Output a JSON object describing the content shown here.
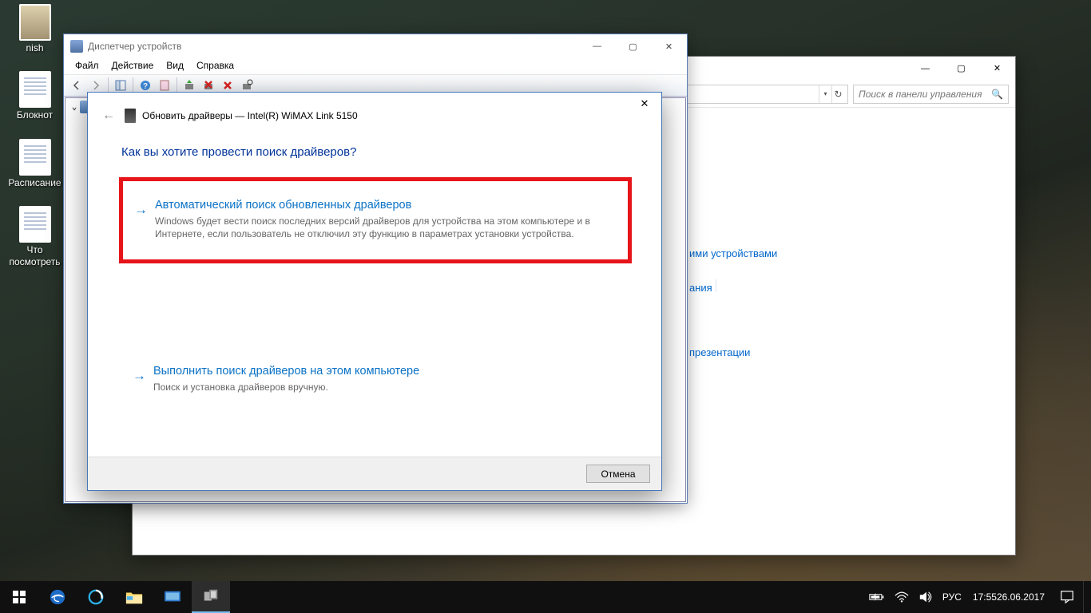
{
  "desktop": {
    "icons": [
      {
        "label": "nish",
        "type": "img"
      },
      {
        "label": "Блокнот",
        "type": "txt"
      },
      {
        "label": "Расписание",
        "type": "txt"
      },
      {
        "label": "Что посмотреть",
        "type": "txt"
      }
    ]
  },
  "controlPanel": {
    "searchPlaceholder": "Поиск в панели управления",
    "links": {
      "a": "ими устройствами",
      "b": "ания",
      "c": "презентации"
    }
  },
  "deviceManager": {
    "title": "Диспетчер устройств",
    "menu": [
      "Файл",
      "Действие",
      "Вид",
      "Справка"
    ]
  },
  "wizard": {
    "title": "Обновить драйверы — Intel(R) WiMAX Link 5150",
    "question": "Как вы хотите провести поиск драйверов?",
    "opt1": {
      "title": "Автоматический поиск обновленных драйверов",
      "desc": "Windows будет вести поиск последних версий драйверов для устройства на этом компьютере и в Интернете, если пользователь не отключил эту функцию в параметрах установки устройства."
    },
    "opt2": {
      "title": "Выполнить поиск драйверов на этом компьютере",
      "desc": "Поиск и установка драйверов вручную."
    },
    "cancel": "Отмена"
  },
  "taskbar": {
    "lang": "РУС",
    "time": "17:55",
    "date": "26.06.2017"
  }
}
